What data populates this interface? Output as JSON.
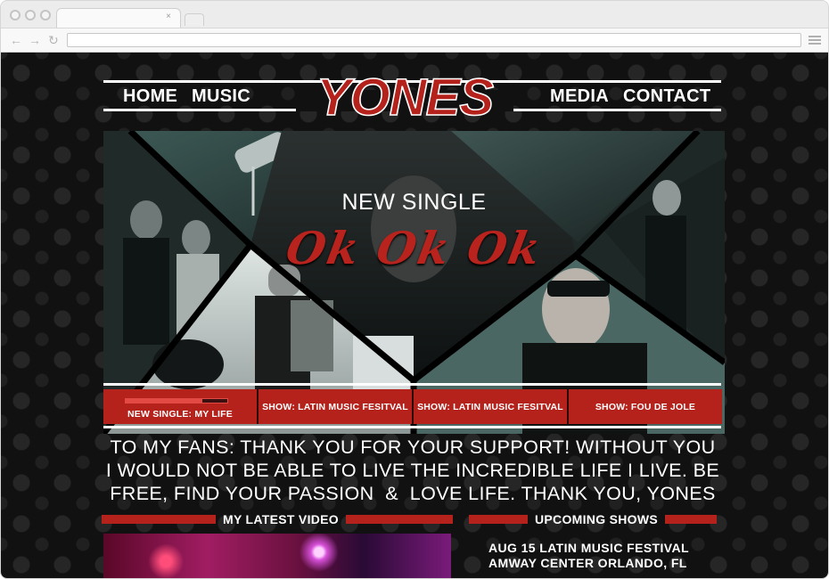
{
  "browser": {
    "back_glyph": "←",
    "forward_glyph": "→",
    "reload_glyph": "↻",
    "tab_close_glyph": "×"
  },
  "site": {
    "logo_text": "YONES",
    "nav": {
      "left": [
        "HOME",
        "MUSIC"
      ],
      "right": [
        "MEDIA",
        "CONTACT"
      ]
    }
  },
  "hero": {
    "title": "NEW SINGLE",
    "script_title": "Ok Ok Ok"
  },
  "feature_tabs": [
    {
      "label": "NEW SINGLE: MY LIFE",
      "active": true,
      "progress": 0.75
    },
    {
      "label": "SHOW: LATIN MUSIC FESITVAL",
      "active": false
    },
    {
      "label": "SHOW: LATIN MUSIC FESITVAL",
      "active": false
    },
    {
      "label": "SHOW: FOU DE JOLE",
      "active": false
    }
  ],
  "fan_message": {
    "line1": "TO MY FANS: THANK YOU FOR YOUR SUPPORT! WITHOUT YOU",
    "line2": "I WOULD NOT BE ABLE TO LIVE THE INCREDIBLE LIFE I LIVE. BE",
    "line3": "FREE, FIND YOUR PASSION  &  LOVE LIFE. THANK YOU, YONES"
  },
  "sections": {
    "video_title": "MY LATEST VIDEO",
    "shows_title": "UPCOMING SHOWS"
  },
  "shows": [
    {
      "line1": "AUG 15 LATIN MUSIC FESTIVAL",
      "line2": "AMWAY CENTER ORLANDO, FL"
    }
  ],
  "colors": {
    "accent_red": "#b5221c",
    "page_bg": "#111111",
    "text": "#ffffff"
  }
}
